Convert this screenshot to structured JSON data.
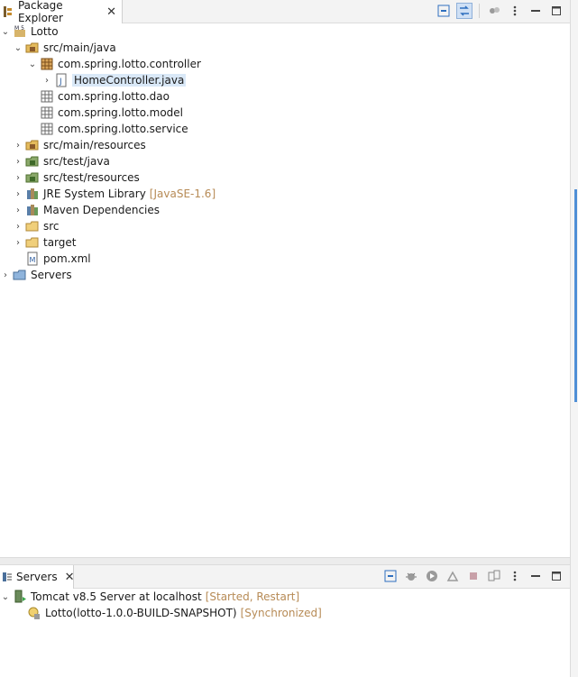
{
  "package_explorer": {
    "tab_title": "Package Explorer",
    "items": [
      {
        "label": "Lotto",
        "icon": "maven-project-icon",
        "level": 0,
        "twisty": "expanded"
      },
      {
        "label": "src/main/java",
        "icon": "source-folder-icon",
        "level": 1,
        "twisty": "expanded"
      },
      {
        "label": "com.spring.lotto.controller",
        "icon": "package-icon",
        "level": 2,
        "twisty": "expanded"
      },
      {
        "label": "HomeController.java",
        "icon": "java-file-icon",
        "level": 3,
        "twisty": "collapsed",
        "selected": true
      },
      {
        "label": "com.spring.lotto.dao",
        "icon": "empty-package-icon",
        "level": 2,
        "twisty": "none"
      },
      {
        "label": "com.spring.lotto.model",
        "icon": "empty-package-icon",
        "level": 2,
        "twisty": "none"
      },
      {
        "label": "com.spring.lotto.service",
        "icon": "empty-package-icon",
        "level": 2,
        "twisty": "none"
      },
      {
        "label": "src/main/resources",
        "icon": "source-folder-icon",
        "level": 1,
        "twisty": "collapsed"
      },
      {
        "label": "src/test/java",
        "icon": "test-source-folder-icon",
        "level": 1,
        "twisty": "collapsed"
      },
      {
        "label": "src/test/resources",
        "icon": "test-source-folder-icon",
        "level": 1,
        "twisty": "collapsed"
      },
      {
        "label": "JRE System Library",
        "decoration": "[JavaSE-1.6]",
        "icon": "library-icon",
        "level": 1,
        "twisty": "collapsed"
      },
      {
        "label": "Maven Dependencies",
        "icon": "library-icon",
        "level": 1,
        "twisty": "collapsed"
      },
      {
        "label": "src",
        "icon": "folder-icon",
        "level": 1,
        "twisty": "collapsed"
      },
      {
        "label": "target",
        "icon": "folder-icon",
        "level": 1,
        "twisty": "collapsed"
      },
      {
        "label": "pom.xml",
        "icon": "maven-pom-icon",
        "level": 1,
        "twisty": "none"
      },
      {
        "label": "Servers",
        "icon": "servers-folder-icon",
        "level": 0,
        "twisty": "collapsed"
      }
    ]
  },
  "servers": {
    "tab_title": "Servers",
    "items": [
      {
        "label": "Tomcat v8.5 Server at localhost",
        "decoration": "[Started, Restart]",
        "icon": "tomcat-server-icon",
        "level": 0,
        "twisty": "expanded"
      },
      {
        "label": "Lotto(lotto-1.0.0-BUILD-SNAPSHOT)",
        "decoration": "[Synchronized]",
        "icon": "web-module-icon",
        "level": 1,
        "twisty": "none"
      }
    ]
  },
  "colors": {
    "decoration": "#b78b56",
    "selection": "#d9e8f7",
    "accent": "#4f8fd6"
  }
}
